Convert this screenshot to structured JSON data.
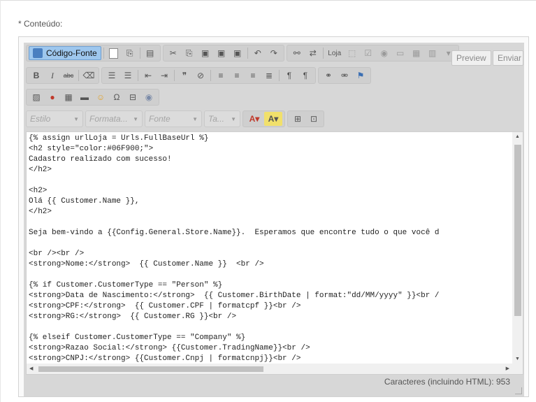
{
  "field_label": "* Conteúdo:",
  "toolbar": {
    "source_label": "Código-Fonte",
    "preview_label": "Preview",
    "send_label": "Enviar",
    "loja_label": "Loja",
    "strike_label": "abc",
    "style_placeholder": "Estilo",
    "format_placeholder": "Formata...",
    "font_placeholder": "Fonte",
    "size_placeholder": "Ta..."
  },
  "code_lines": [
    "{% assign urlLoja = Urls.FullBaseUrl %}",
    "<h2 style=\"color:#06F900;\">",
    "Cadastro realizado com sucesso!",
    "</h2>",
    "",
    "<h2>",
    "Olá {{ Customer.Name }},",
    "</h2>",
    "",
    "Seja bem-vindo a {{Config.General.Store.Name}}.  Esperamos que encontre tudo o que você d",
    "",
    "<br /><br />",
    "<strong>Nome:</strong>  {{ Customer.Name }}  <br />",
    "",
    "{% if Customer.CustomerType == \"Person\" %}",
    "<strong>Data de Nascimento:</strong>  {{ Customer.BirthDate | format:\"dd/MM/yyyy\" }}<br /",
    "<strong>CPF:</strong>  {{ Customer.CPF | formatcpf }}<br />",
    "<strong>RG:</strong>  {{ Customer.RG }}<br />",
    "",
    "{% elseif Customer.CustomerType == \"Company\" %}",
    "<strong>Razao Social:</strong> {{Customer.TradingName}}<br />",
    "<strong>CNPJ:</strong> {{Customer.Cnpj | formatcnpj}}<br />"
  ],
  "footer_text": "Caracteres (incluindo HTML): 953"
}
